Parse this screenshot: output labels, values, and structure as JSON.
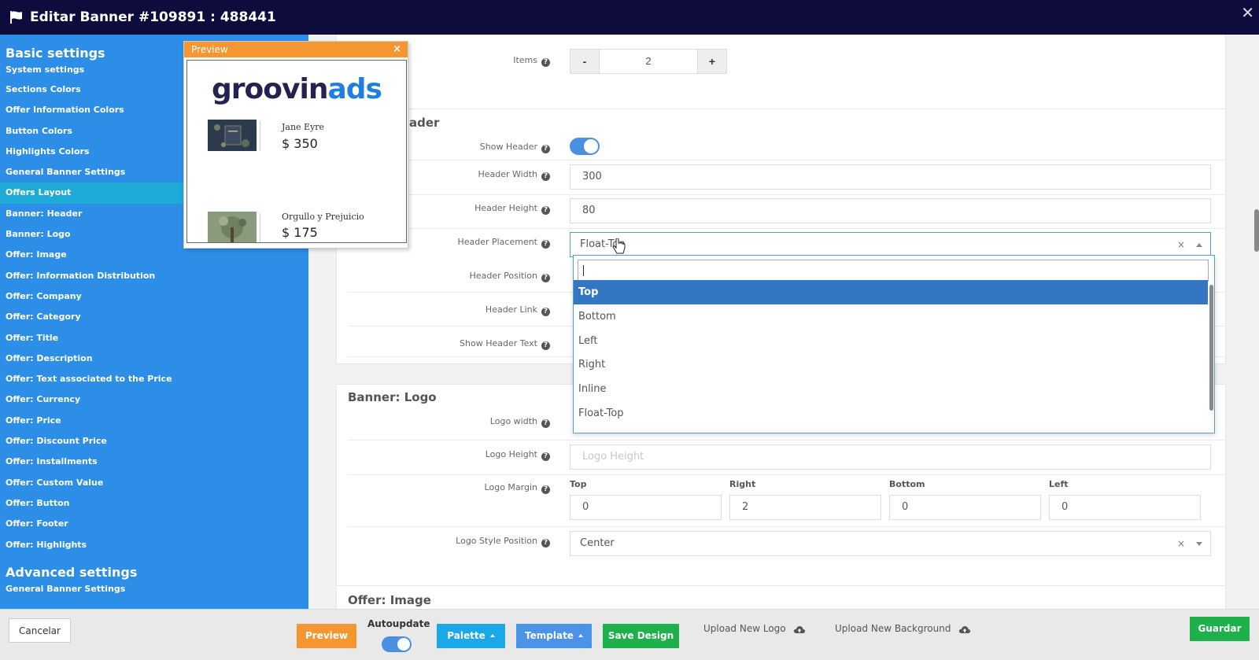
{
  "window": {
    "title": "Editar Banner #109891 : 488441"
  },
  "sidebar": {
    "basic_title": "Basic settings",
    "items": [
      {
        "label": "System settings"
      },
      {
        "label": "Sections Colors"
      },
      {
        "label": "Offer Information Colors"
      },
      {
        "label": "Button Colors"
      },
      {
        "label": "Highlights Colors"
      },
      {
        "label": "General Banner Settings"
      },
      {
        "label": "Offers Layout",
        "active": true
      },
      {
        "label": "Banner: Header"
      },
      {
        "label": "Banner: Logo"
      },
      {
        "label": "Offer: Image"
      },
      {
        "label": "Offer: Information Distribution"
      },
      {
        "label": "Offer: Company"
      },
      {
        "label": "Offer: Category"
      },
      {
        "label": "Offer: Title"
      },
      {
        "label": "Offer: Description"
      },
      {
        "label": "Offer: Text associated to the Price"
      },
      {
        "label": "Offer: Currency"
      },
      {
        "label": "Offer: Price"
      },
      {
        "label": "Offer: Discount Price"
      },
      {
        "label": "Offer: Installments"
      },
      {
        "label": "Offer: Custom Value"
      },
      {
        "label": "Offer: Button"
      },
      {
        "label": "Offer: Footer"
      },
      {
        "label": "Offer: Highlights"
      }
    ],
    "advanced_title": "Advanced settings",
    "advanced_items": [
      {
        "label": "General Banner Settings"
      }
    ]
  },
  "items_row": {
    "label": "Items",
    "minus": "-",
    "value": "2",
    "plus": "+"
  },
  "header_section": {
    "title": "ader",
    "show_header_label": "Show Header",
    "show_header_on": true,
    "width_label": "Header Width",
    "width_value": "300",
    "height_label": "Header Height",
    "height_value": "80",
    "placement_label": "Header Placement",
    "placement_value": "Float-Top",
    "position_label": "Header Position",
    "link_label": "Header Link",
    "show_text_label": "Show Header Text"
  },
  "dropdown": {
    "search_value": "",
    "options": [
      "Top",
      "Bottom",
      "Left",
      "Right",
      "Inline",
      "Float-Top"
    ],
    "highlighted": "Top"
  },
  "logo_section": {
    "title": "Banner: Logo",
    "width_label": "Logo width",
    "height_label": "Logo Height",
    "height_placeholder": "Logo Height",
    "margin_label": "Logo Margin",
    "margin": {
      "top_label": "Top",
      "top": "0",
      "right_label": "Right",
      "right": "2",
      "bottom_label": "Bottom",
      "bottom": "0",
      "left_label": "Left",
      "left": "0"
    },
    "style_position_label": "Logo Style Position",
    "style_position_value": "Center"
  },
  "image_section": {
    "title": "Offer: Image"
  },
  "preview": {
    "title": "Preview",
    "close": "×",
    "logo_left": "groovin",
    "logo_right": "ads",
    "offers": [
      {
        "title": "Jane Eyre",
        "price": "$ 350"
      },
      {
        "title": "Orgullo y Prejuicio",
        "price": "$ 175"
      }
    ]
  },
  "bottombar": {
    "cancel": "Cancelar",
    "preview": "Preview",
    "autoupdate": "Autoupdate",
    "autoupdate_on": true,
    "palette": "Palette",
    "template": "Template",
    "save_design": "Save Design",
    "upload_logo": "Upload New Logo",
    "upload_background": "Upload New Background",
    "save": "Guardar"
  },
  "colors": {
    "titlebar": "#0d0c3c",
    "sidebar": "#2d8ee8",
    "sidebar_active": "#1eaad6",
    "orange": "#f59631",
    "green": "#1eb04b",
    "highlight": "#3377c2"
  }
}
